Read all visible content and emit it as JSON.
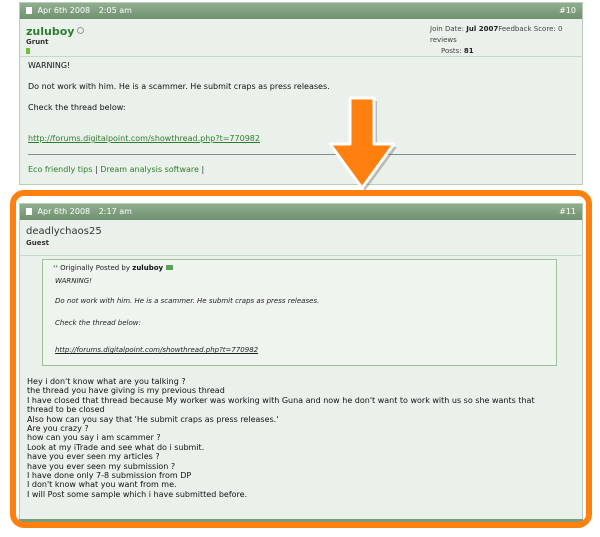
{
  "post1": {
    "date": "Apr 6th 2008",
    "time": "2:05 am",
    "number": "#10",
    "username": "zuluboy",
    "rank": "Grunt",
    "join_label": "Join Date:",
    "join_value": "Jul 2007",
    "feedback_label": "Feedback Score:",
    "feedback_value": "0 reviews",
    "posts_label": "Posts:",
    "posts_value": "81",
    "lines": [
      "WARNING!",
      "Do not work with him. He is a scammer. He submit craps as press releases.",
      "Check the thread below:",
      "http://forums.digitalpoint.com/showthread.php?t=770982"
    ],
    "sig_link1": "Eco friendly tips",
    "sig_sep": "|",
    "sig_link2": "Dream analysis software",
    "sig_sep2": "|"
  },
  "post2": {
    "date": "Apr 6th 2008",
    "time": "2:17 am",
    "number": "#11",
    "username": "deadlychaos25",
    "rank": "Guest",
    "quote": {
      "prefix": "Originally Posted by",
      "author": "zuluboy",
      "lines": [
        "WARNING!",
        "Do not work with him. He is a scammer. He submit craps as press releases.",
        "Check the thread below:",
        "http://forums.digitalpoint.com/showthread.php?t=770982"
      ]
    },
    "reply": [
      "Hey i don't know what are you talking ?",
      "the thread you have giving is my previous thread",
      "I have closed that thread because My worker was working with Guna and now he don't want to work with us so she wants that",
      "thread to be closed",
      "Also how can you say that 'He submit craps as press releases.'",
      "Are you crazy ?",
      "how can you say i am scammer ?",
      "Look at my iTrade and see what do i submit.",
      "have you ever seen my articles ?",
      "have you ever seen my submission ?",
      "I have done only 7-8 submission from DP",
      "I don't know what you want from me.",
      "I will Post some sample which i have submitted before."
    ]
  },
  "colors": {
    "header_green": "#7a9c7a",
    "post_bg": "#eaf1ea",
    "highlight_orange": "#ff7f0f",
    "link_green": "#2e7d2e"
  }
}
